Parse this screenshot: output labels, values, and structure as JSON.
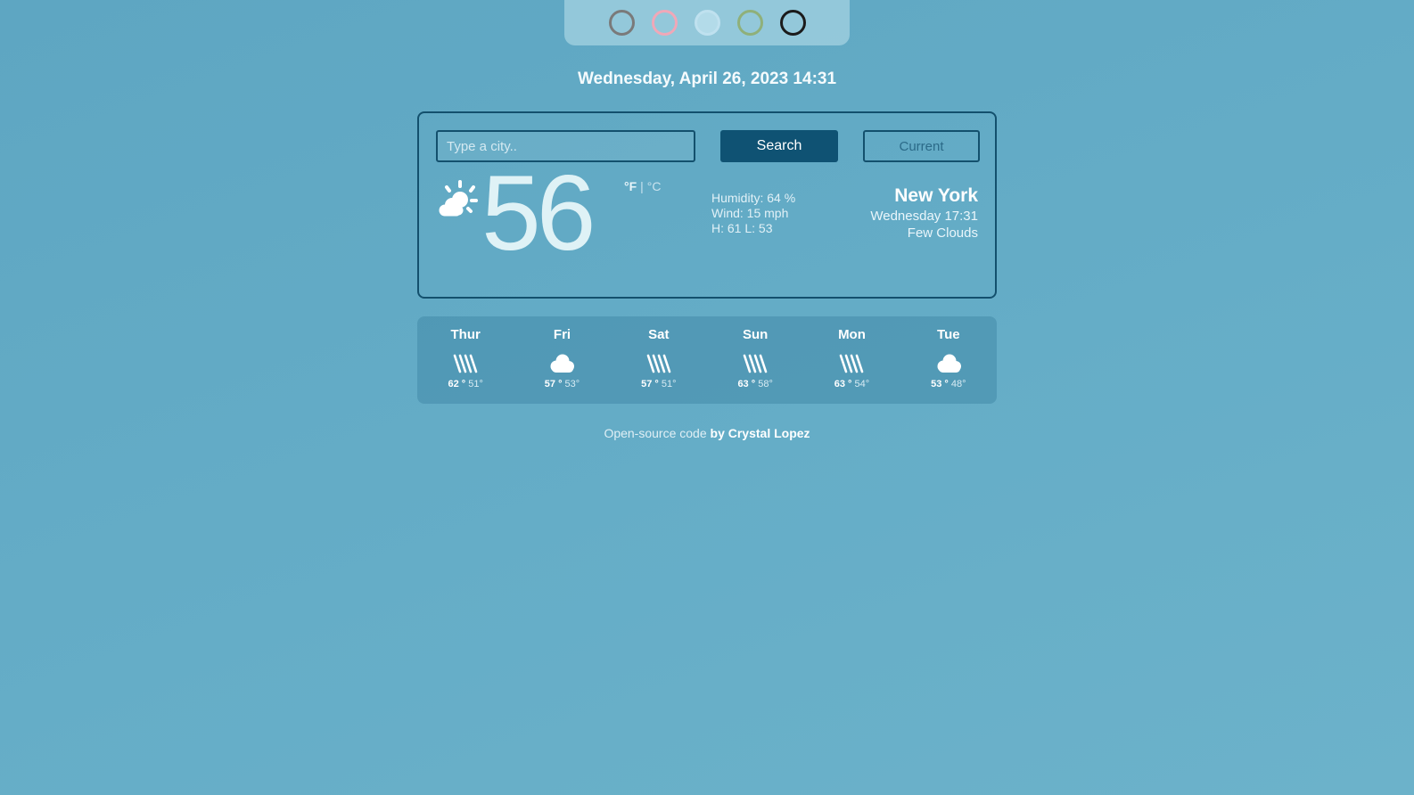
{
  "theme": {
    "swatches": [
      {
        "name": "gray",
        "color": "#7a7a7a"
      },
      {
        "name": "pink",
        "color": "#f0a8b8"
      },
      {
        "name": "light-blue",
        "color": "#bfe1ef"
      },
      {
        "name": "green",
        "color": "#8fb07a"
      },
      {
        "name": "black",
        "color": "#1b1b1b"
      }
    ]
  },
  "datetime": "Wednesday, April 26, 2023 14:31",
  "search": {
    "placeholder": "Type a city..",
    "search_label": "Search",
    "current_label": "Current"
  },
  "current": {
    "icon": "sun-cloud-icon",
    "temperature": "56",
    "unit_f": "°F",
    "unit_separator": "|",
    "unit_c": "°C",
    "humidity": "Humidity: 64 %",
    "wind": "Wind: 15 mph",
    "hilo": "H: 61 L: 53",
    "city": "New York",
    "local_time": "Wednesday 17:31",
    "description": "Few Clouds"
  },
  "forecast": [
    {
      "day": "Thur",
      "icon": "rain-icon",
      "high": "62 °",
      "low": "51°"
    },
    {
      "day": "Fri",
      "icon": "cloud-icon",
      "high": "57 °",
      "low": "53°"
    },
    {
      "day": "Sat",
      "icon": "rain-icon",
      "high": "57 °",
      "low": "51°"
    },
    {
      "day": "Sun",
      "icon": "rain-icon",
      "high": "63 °",
      "low": "58°"
    },
    {
      "day": "Mon",
      "icon": "rain-icon",
      "high": "63 °",
      "low": "54°"
    },
    {
      "day": "Tue",
      "icon": "cloud-icon",
      "high": "53 °",
      "low": "48°"
    }
  ],
  "footer": {
    "text": "Open-source code",
    "author": "by Crystal Lopez"
  },
  "colors": {
    "background": "#62aac5",
    "accent": "#0f5273",
    "border": "#13506d"
  }
}
